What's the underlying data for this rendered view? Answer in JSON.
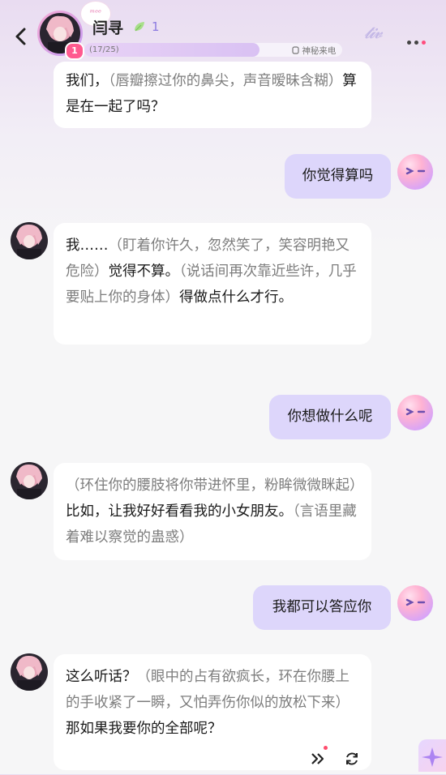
{
  "header": {
    "character_name": "闫寻",
    "level": "1",
    "heart_badge": "1",
    "deco_badge": "ᵐᵉᵉ",
    "progress_text": "(17/25)",
    "progress_value": 0.68,
    "mystery_call": "神秘来电",
    "deco_glyph": "𝓽𝓲𝓿",
    "icons": [
      "back-icon",
      "leaf-icon",
      "phone-icon",
      "more-icon"
    ]
  },
  "messages": [
    {
      "role": "ai",
      "parts": [
        {
          "text": "我们，",
          "kind": "speech"
        },
        {
          "text": "（唇瓣擦过你的鼻尖，声音暧昧含糊）",
          "kind": "action"
        },
        {
          "text": "算是在一起了吗？",
          "kind": "speech"
        }
      ]
    },
    {
      "role": "user",
      "text": "你觉得算吗"
    },
    {
      "role": "ai",
      "parts": [
        {
          "text": "我……",
          "kind": "speech"
        },
        {
          "text": "（盯着你许久，忽然笑了，笑容明艳又危险）",
          "kind": "action"
        },
        {
          "text": "觉得不算。",
          "kind": "speech"
        },
        {
          "text": "（说话间再次靠近些许，几乎要贴上你的身体）",
          "kind": "action"
        },
        {
          "text": "得做点什么才行。",
          "kind": "speech"
        }
      ]
    },
    {
      "role": "user",
      "text": "你想做什么呢"
    },
    {
      "role": "ai",
      "parts": [
        {
          "text": "（环住你的腰肢将你带进怀里，粉眸微微眯起）",
          "kind": "action"
        },
        {
          "text": "比如，让我好好看看我的小女朋友。",
          "kind": "speech"
        },
        {
          "text": "（言语里藏着难以察觉的蛊惑）",
          "kind": "action"
        }
      ]
    },
    {
      "role": "user",
      "text": "我都可以答应你"
    },
    {
      "role": "ai",
      "parts": [
        {
          "text": "这么听话？",
          "kind": "speech"
        },
        {
          "text": "（眼中的占有欲疯长，环在你腰上的手收紧了一瞬，又怕弄伤你似的放松下来）",
          "kind": "action"
        },
        {
          "text": "那如果我要你的全部呢？",
          "kind": "speech"
        }
      ]
    }
  ],
  "bottom_actions": {
    "icons": [
      "play-forward-icon",
      "regenerate-icon",
      "sparkle-icon"
    ]
  },
  "colors": {
    "user_bubble": "#ddd6fb",
    "ai_bubble": "#ffffff",
    "action_text": "#7d7d7d",
    "accent": "#ff4d7d"
  }
}
